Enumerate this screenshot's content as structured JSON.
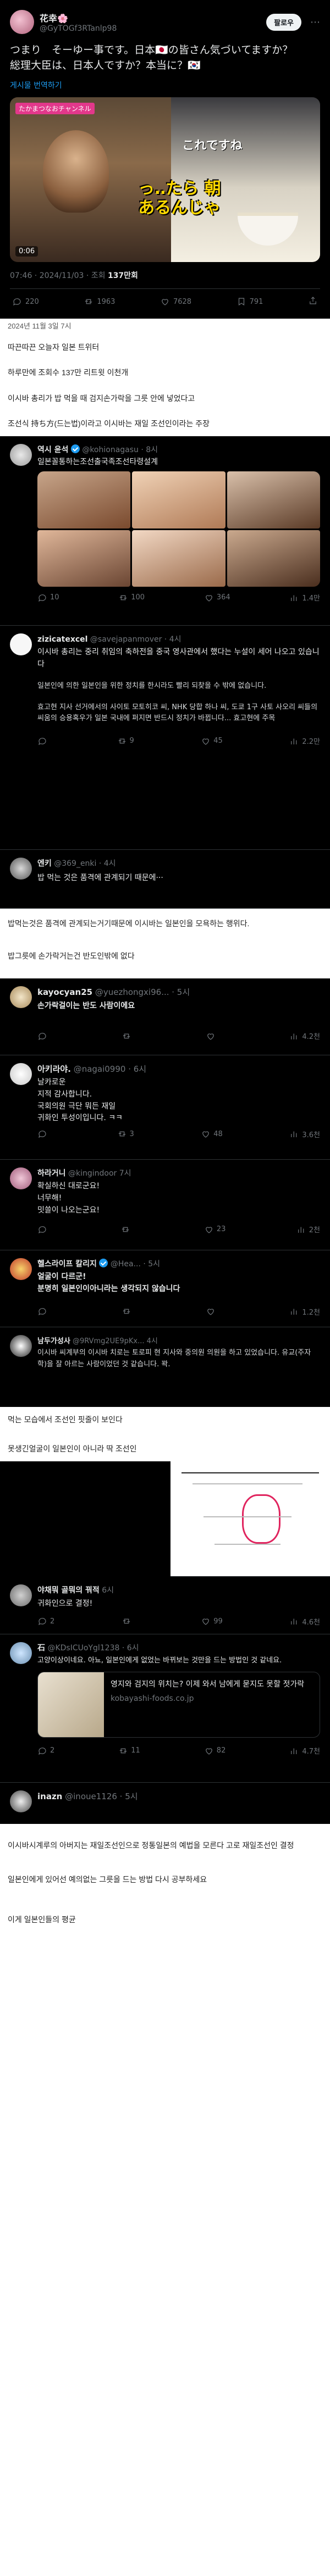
{
  "tweet1": {
    "display_name": "花幸🌸",
    "handle": "@GyTOGf3RTanlp98",
    "follow_label": "팔로우",
    "text": "つまり　そーゆー事です。日本🇯🇵の皆さん気づいてますか？\n総理大臣は、日本人ですか？本当に？🇰🇷",
    "translate_label": "게시물 번역하기",
    "video_caption_left": "たかまつなおチャンネル",
    "video_caption_mid": "っ‥たら 朝 \nあるんじゃ",
    "video_caption_right": "これですね",
    "video_time": "0:06",
    "meta": "07:46 · 2024/11/03 · 조회",
    "views": "137만회",
    "stats": {
      "replies": "220",
      "retweets": "1963",
      "likes": "7628",
      "bookmarks": "791"
    }
  },
  "prose1": {
    "date": "2024년 11월 3일 7시",
    "p1": "따끈따끈 오늘자 일본 트위터",
    "p2": "하루만에 조회수 137만 리트윗 이천개",
    "p3": "이시바 총리가 밥 먹을 때 검지손가락을 그릇 안에 넣었다고",
    "p4": "조선식 持ち方(드는법)이라고 이시바는 재일 조선인이라는 주장"
  },
  "tweet2": {
    "display_name": "역시 윤석",
    "handle": "@kohionagasu · 8시",
    "text": "일본꼴통하는조선출국족조선타령설계",
    "stats": {
      "replies": "10",
      "retweets": "100",
      "likes": "364",
      "views": "1.4만"
    }
  },
  "tweet3": {
    "display_name": "zizicatexcel",
    "handle": "@savejapanmover · 4시",
    "text": "이시바 총리는 중리 취임의 축하전을 중국 영사관에서 했다는 누설이 세어 나오고 있습니다",
    "quote_text_1": "일본인에 의한 일본인을 위한 정치를 한시라도 빨리 되찾을 수 밖에 없습니다.",
    "quote_text_2": "효고현 지사 선거에서의 사이토 모토히코 씨, NHK 당합 하나 씨, 도쿄 1구 사토 사오리 씨들의 씨움의 승용혹우가 일본 국내에 퍼지면 반드시 정치가 바뀝니다... 효고현에 주목",
    "stats": {
      "replies": "",
      "retweets": "9",
      "likes": "45",
      "views": "2.2만"
    }
  },
  "tweet4": {
    "display_name": "엔키",
    "handle": "@369_enki · 4시",
    "text": "밥 먹는 것은 품격에 관계되기 때문에···"
  },
  "prose2": {
    "p1": "밥먹는것은 품격에 관계되는거기때문에 이시바는 일본인을 모욕하는 행위다.",
    "p2": "밥그릇에 손가락거는건 반도인밖에 없다"
  },
  "reply_list": [
    {
      "name": "kayocyan25",
      "handle": "@yuezhongxi96... · 5시",
      "text": "손가락걸이는 반도 사람이에요",
      "stats": [
        "",
        "",
        "",
        "4.2천"
      ]
    },
    {
      "name": "아키라야.",
      "handle": "@nagai0990 · 6시",
      "text": "날카로운\n지적 감사합니다.\n국회의원 극단 뭐든 재일\n귀화인 투성이입니다. ㅋㅋ",
      "stats": [
        "",
        "3",
        "48",
        "3.6천"
      ]
    },
    {
      "name": "하라거니",
      "handle": "@kingindoor 7시",
      "text": "확실하신 대로군요!\n너무해!\n밋쓸이 나오는군요!",
      "stats": [
        "",
        "",
        "23",
        "2천"
      ]
    },
    {
      "name": "헬스라이프 칼리지",
      "handle": "@Hea... · 5시",
      "text": "얼굴이 다르군!\n분명히 일본인이아니라는 생각되지 않습니다",
      "stats": [
        "",
        "",
        "",
        "1.2천"
      ]
    },
    {
      "name": "남두가성사",
      "handle": "@9RVmg2UE9pKx... 4시",
      "text": "이시바 씨계부의 이시바 치로는 토로피 현 지사와 중의원 의원을 하고 있었습니다. 유교(주자학)을 잘 아르는 사람이었던 것 같습니다. 꽉.",
      "stats": [
        "",
        "",
        "",
        ""
      ]
    }
  ],
  "prose3": {
    "p1": "먹는 모습에서 조선인 핏줄이 보인다",
    "p2": "못생긴얼굴이 일본인이 아니라 딱 조선인"
  },
  "reply_list2": [
    {
      "name": "야채뭐 골뭐의 꿔적",
      "handle": "6시",
      "text": "귀화인으로 결정!",
      "stats": [
        "2",
        "",
        "99",
        "4.6천"
      ]
    },
    {
      "name": "石",
      "handle": "@KDsICUoYgl1238 · 6시",
      "text": "고양이상이네요. 아뇨, 일본인에게 없었는 바뀌보는 것만을 드는 방법인 것 같네요.",
      "link_title": "영지와 검지의 위치는? 이제 와서 남에게 묻지도 못할 젓가락",
      "link_domain": "kobayashi-foods.co.jp",
      "stats": [
        "2",
        "11",
        "82",
        "4.7천"
      ]
    },
    {
      "name": "inazn",
      "handle": "@inoue1126 · 5시",
      "text": "",
      "stats": [
        "",
        "",
        "",
        ""
      ]
    }
  ],
  "prose4": {
    "p1": "이시바시계루의 아버지는 재일조선인으로 정통일본의 예법을 모른다 고로 재일조선인 결정",
    "p2": "일본인에게 있어선 예의없는 그릇을 드는 방법 다시 공부하세요",
    "p3": "이게 일본인들의 평균"
  }
}
